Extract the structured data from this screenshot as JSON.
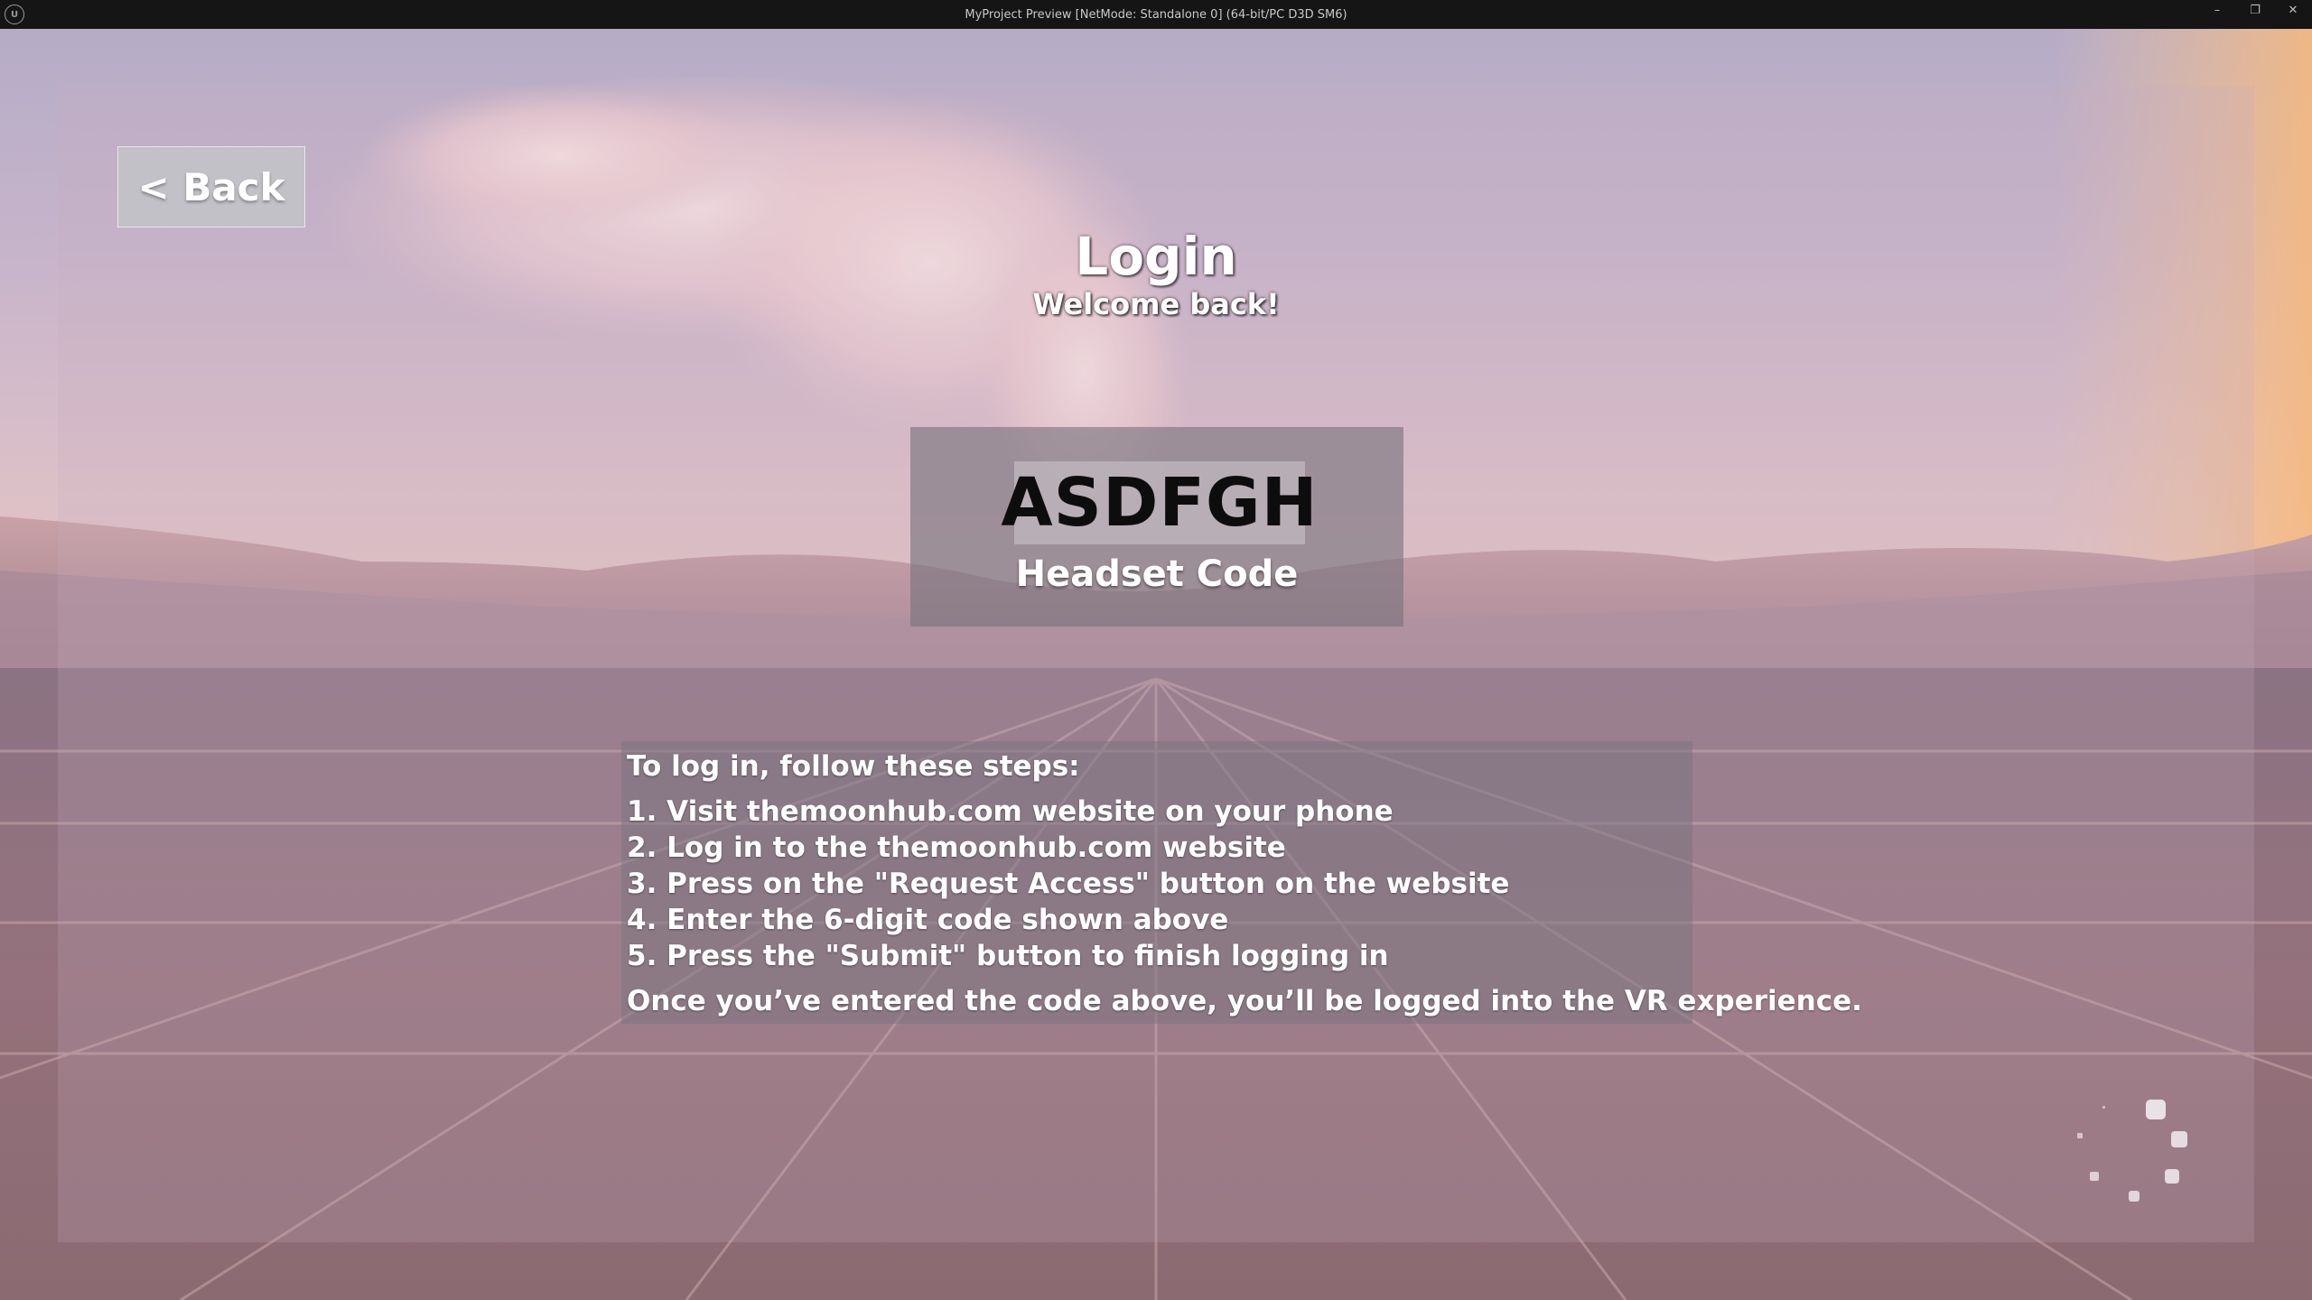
{
  "window": {
    "title": "MyProject Preview [NetMode: Standalone 0]  (64-bit/PC D3D SM6)",
    "logo_text": "U",
    "controls": {
      "minimize": "–",
      "restore": "❐",
      "close": "✕"
    }
  },
  "login": {
    "back_label": "< Back",
    "title": "Login",
    "subtitle": "Welcome back!",
    "headset_code": "ASDFGH",
    "headset_code_label": "Headset Code"
  },
  "instructions": {
    "intro": "To log in, follow these steps:",
    "steps": [
      "1. Visit themoonhub.com website on your phone",
      "2. Log in to the themoonhub.com website",
      "3. Press on the \"Request Access\" button on the website",
      "4. Enter the 6-digit code shown above",
      "5. Press the \"Submit\" button to finish logging in"
    ],
    "outro": "Once you’ve entered the code above, you’ll be logged into the VR experience."
  },
  "icons": {
    "engine_logo": "unreal-logo-icon",
    "loading": "loading-spinner-icon"
  },
  "colors": {
    "titlebar": "#151515",
    "panel_tint": "#c8afbe",
    "code_text": "#0d0d0d",
    "text": "#ffffff"
  }
}
